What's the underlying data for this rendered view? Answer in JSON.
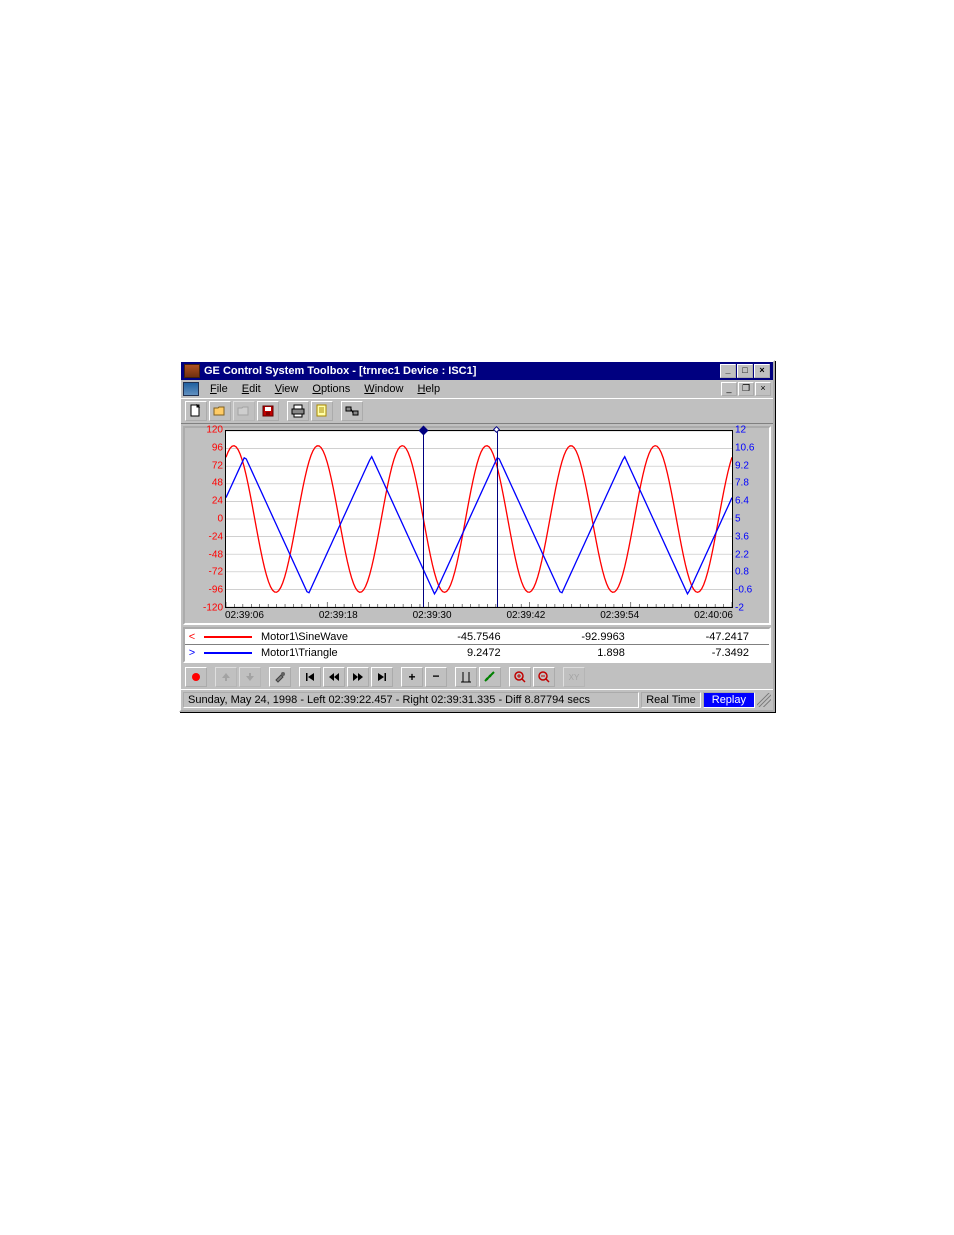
{
  "title": "GE Control System Toolbox - [trnrec1      Device : ISC1]",
  "menu": [
    "File",
    "Edit",
    "View",
    "Options",
    "Window",
    "Help"
  ],
  "chart_data": {
    "type": "line",
    "xlabel": "",
    "x_ticks": [
      "02:39:06",
      "02:39:18",
      "02:39:30",
      "02:39:42",
      "02:39:54",
      "02:40:06"
    ],
    "series": [
      {
        "name": "Motor1\\SineWave",
        "color": "#ff0000",
        "axis": "left",
        "ylim": [
          -120,
          120
        ],
        "yticks": [
          120,
          96,
          72,
          48,
          24,
          0,
          -24,
          -48,
          -72,
          -96,
          -120
        ]
      },
      {
        "name": "Motor1\\Triangle",
        "color": "#0000ff",
        "axis": "right",
        "ylim": [
          -2,
          12
        ],
        "yticks": [
          12,
          10.6,
          9.2,
          7.8,
          6.4,
          5,
          3.6,
          2.2,
          0.8,
          -0.6,
          -2
        ]
      }
    ],
    "cursors": {
      "left_pct": 39.0,
      "right_pct": 53.5
    }
  },
  "signals": [
    {
      "pick": "<",
      "color": "#ff0000",
      "name": "Motor1\\SineWave",
      "v1": "-45.7546",
      "v2": "-92.9963",
      "v3": "-47.2417"
    },
    {
      "pick": ">",
      "color": "#0000ff",
      "name": "Motor1\\Triangle",
      "v1": "9.2472",
      "v2": "1.898",
      "v3": "-7.3492"
    }
  ],
  "status": {
    "main": "Sunday, May 24, 1998 - Left 02:39:22.457 - Right 02:39:31.335 - Diff 8.87794 secs",
    "realtime": "Real Time",
    "replay": "Replay"
  }
}
